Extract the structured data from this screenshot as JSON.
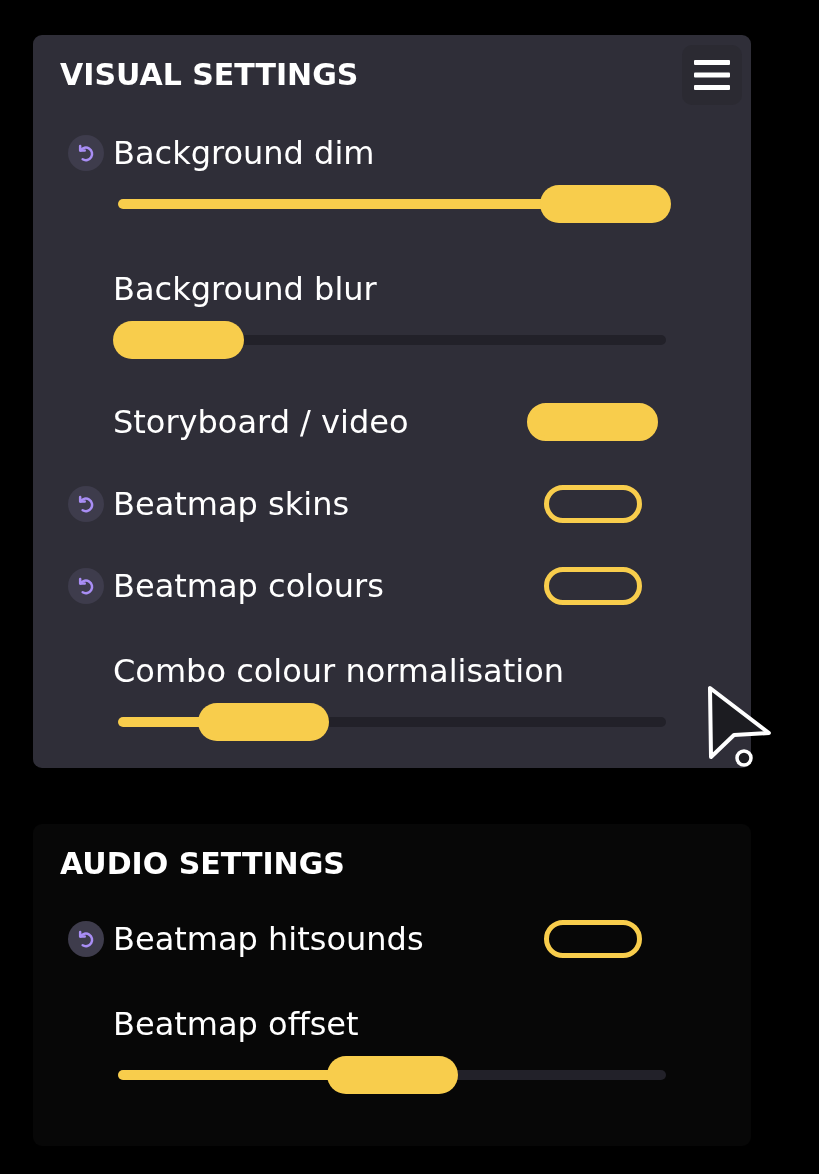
{
  "sections": [
    {
      "title": "VISUAL SETTINGS",
      "hovered": true,
      "menu": true,
      "items": [
        {
          "kind": "slider",
          "label": "Background dim",
          "reset": true,
          "level": 1
        },
        {
          "kind": "slider",
          "label": "Background blur",
          "reset": false,
          "level": 0
        },
        {
          "kind": "toggle",
          "label": "Storyboard / video",
          "reset": false,
          "on": true
        },
        {
          "kind": "toggle",
          "label": "Beatmap skins",
          "reset": true,
          "on": false
        },
        {
          "kind": "toggle",
          "label": "Beatmap colours",
          "reset": true,
          "on": false
        },
        {
          "kind": "slider",
          "label": "Combo colour normalisation",
          "reset": false,
          "level": 0.2
        }
      ]
    },
    {
      "title": "AUDIO SETTINGS",
      "hovered": false,
      "menu": false,
      "items": [
        {
          "kind": "toggle",
          "label": "Beatmap hitsounds",
          "reset": true,
          "on": false
        },
        {
          "kind": "slider",
          "label": "Beatmap offset",
          "reset": false,
          "level": 0.5
        }
      ]
    }
  ]
}
